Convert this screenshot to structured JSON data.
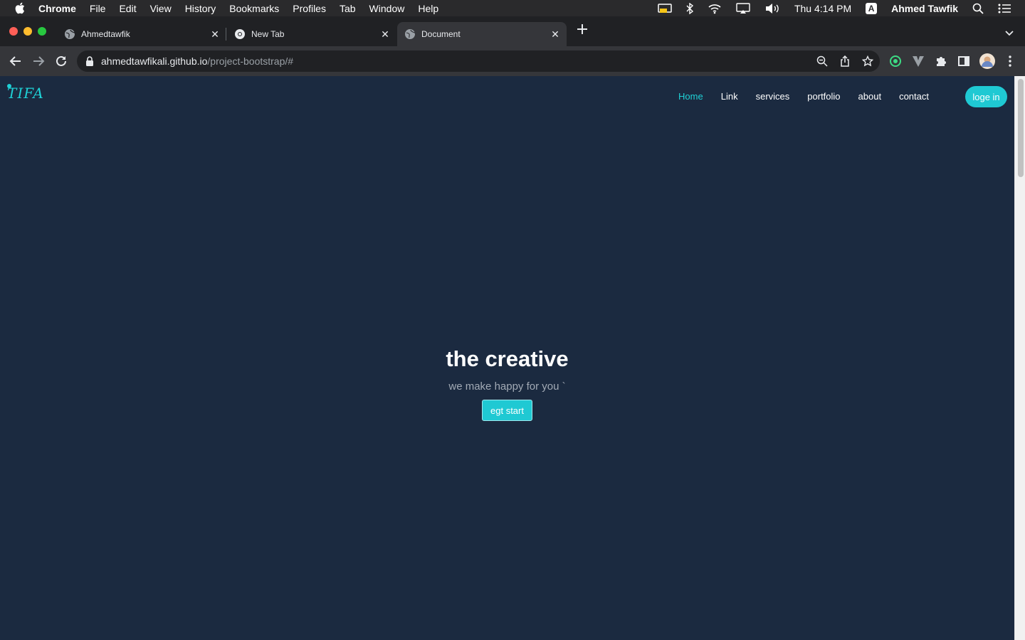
{
  "menubar": {
    "app": "Chrome",
    "items": [
      "File",
      "Edit",
      "View",
      "History",
      "Bookmarks",
      "Profiles",
      "Tab",
      "Window",
      "Help"
    ],
    "clock": "Thu 4:14 PM",
    "input_source": "A",
    "user": "Ahmed Tawfik",
    "status_icons": [
      "display-icon",
      "bluetooth-icon",
      "wifi-icon",
      "airplay-icon",
      "volume-icon",
      "spotlight-icon",
      "control-center-icon"
    ]
  },
  "tabs": [
    {
      "title": "Ahmedtawfik",
      "icon": "globe-icon",
      "active": false
    },
    {
      "title": "New Tab",
      "icon": "chrome-icon",
      "active": false
    },
    {
      "title": "Document",
      "icon": "globe-icon",
      "active": true
    }
  ],
  "toolbar": {
    "url_host": "ahmedtawfikali.github.io",
    "url_path": "/project-bootstrap/#",
    "icons": [
      "zoom-icon",
      "share-icon",
      "bookmark-star-icon",
      "extension-green-icon",
      "vuetify-icon",
      "puzzle-icon",
      "sidebar-icon",
      "profile-avatar",
      "menu-dots-icon"
    ]
  },
  "page": {
    "brand": "TIFA",
    "nav": [
      {
        "label": "Home",
        "active": true
      },
      {
        "label": "Link",
        "active": false
      },
      {
        "label": "services",
        "active": false
      },
      {
        "label": "portfolio",
        "active": false
      },
      {
        "label": "about",
        "active": false
      },
      {
        "label": "contact",
        "active": false
      }
    ],
    "login_label": "loge in",
    "hero_title": "the creative",
    "hero_tagline": "we make happy for you `",
    "hero_button": "egt start",
    "colors": {
      "background": "#1b2a40",
      "accent": "#1fd1d6",
      "button": "#1fc9d3"
    }
  }
}
